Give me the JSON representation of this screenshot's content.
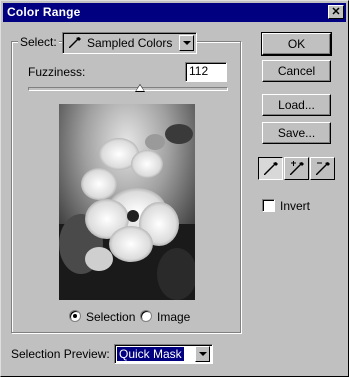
{
  "window": {
    "title": "Color Range",
    "close_glyph": "✕"
  },
  "select": {
    "label": "Select:",
    "value": "Sampled Colors",
    "icon": "eyedropper-icon"
  },
  "fuzziness": {
    "label": "Fuzziness:",
    "value": "112",
    "slider_fraction": 0.56
  },
  "view": {
    "selection_label": "Selection",
    "image_label": "Image",
    "selected": "Selection"
  },
  "preview_selection": {
    "label": "Selection Preview:",
    "value": "Quick Mask"
  },
  "buttons": {
    "ok": "OK",
    "cancel": "Cancel",
    "load": "Load...",
    "save": "Save..."
  },
  "tools": {
    "items": [
      "eyedropper-icon",
      "eyedropper-plus-icon",
      "eyedropper-minus-icon"
    ],
    "active": "eyedropper-icon"
  },
  "invert": {
    "label": "Invert",
    "checked": false
  },
  "colors": {
    "title_bar": "#000080",
    "face": "#c0c0c0",
    "highlight_field": "#000080"
  }
}
